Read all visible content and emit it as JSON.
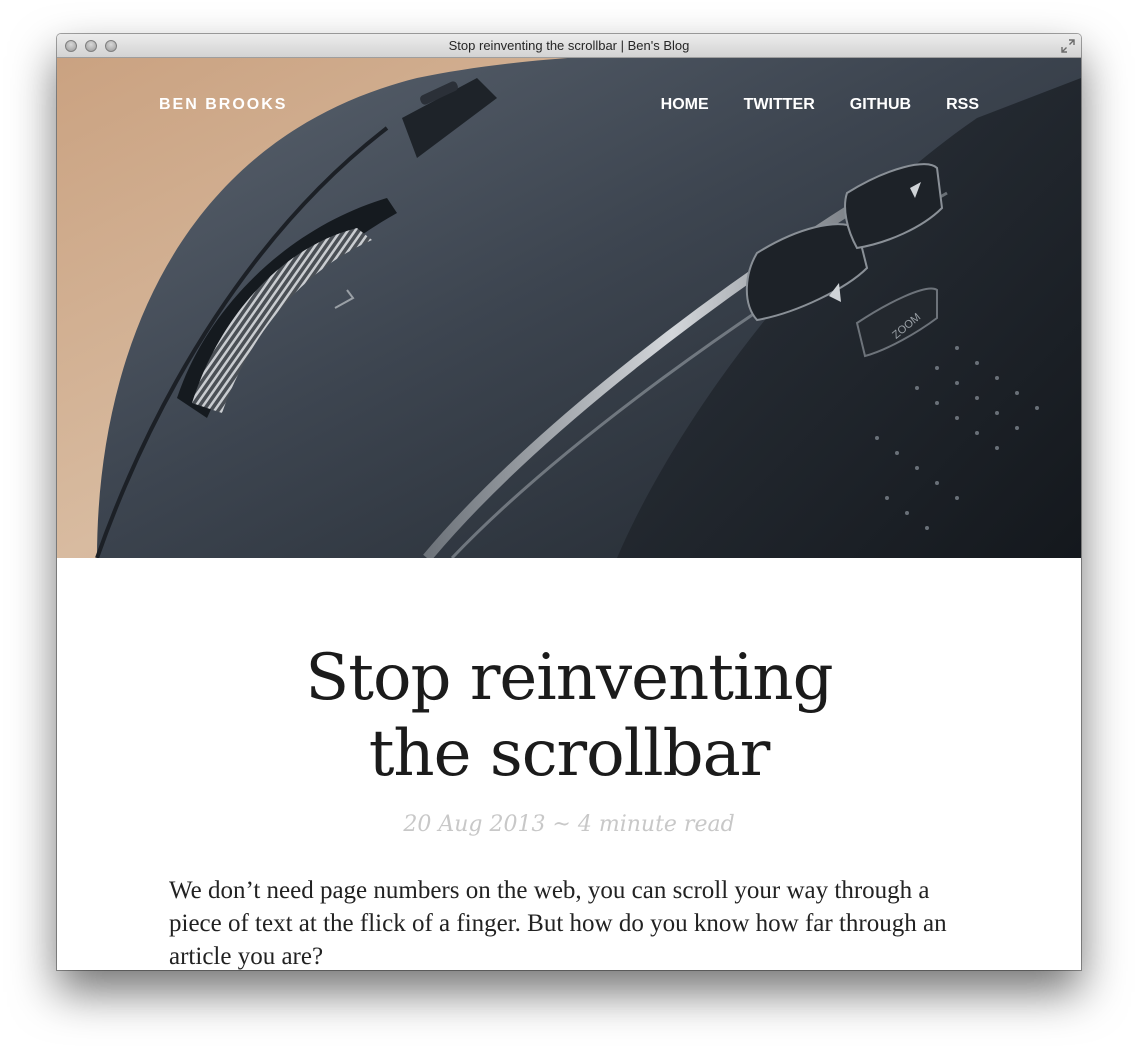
{
  "window": {
    "title": "Stop reinventing the scrollbar | Ben's Blog"
  },
  "icons": {
    "close": "traffic-light-icon",
    "minimize": "traffic-light-icon",
    "zoom": "traffic-light-icon",
    "fullscreen": "fullscreen-arrows-icon"
  },
  "site": {
    "name": "BEN BROOKS"
  },
  "nav": {
    "items": [
      "HOME",
      "TWITTER",
      "GITHUB",
      "RSS"
    ]
  },
  "hero": {
    "description_icon": "mouse-photo",
    "zoom_label": "ZOOM"
  },
  "post": {
    "title_line1": "Stop reinventing",
    "title_line2": "the scrollbar",
    "meta": "20 Aug 2013 ~ 4 minute read",
    "body": "We don’t need page numbers on the web, you can scroll your way through a piece of text at the flick of a finger. But how do you know how far through an article you are?"
  },
  "colors": {
    "meta": "#c8c8c8",
    "title": "#1b1b1b",
    "nav": "#ffffff"
  }
}
